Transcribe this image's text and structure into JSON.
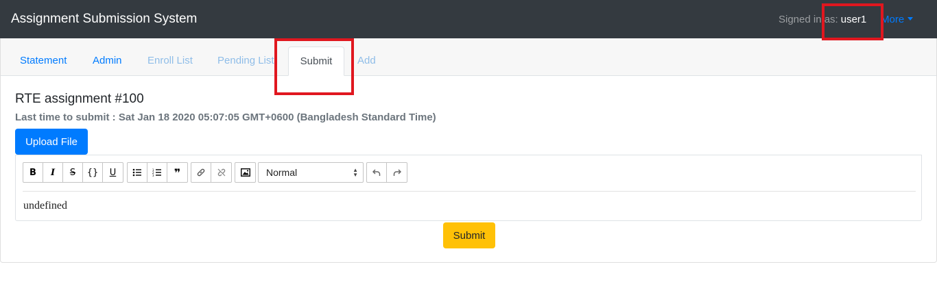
{
  "navbar": {
    "brand": "Assignment Submission System",
    "signed_in_label": "Signed in as:",
    "username": "user1",
    "more_label": "More"
  },
  "tabs": [
    {
      "label": "Statement"
    },
    {
      "label": "Admin"
    },
    {
      "label": "Enroll List"
    },
    {
      "label": "Pending List"
    },
    {
      "label": "Submit",
      "active": true
    },
    {
      "label": "Add"
    }
  ],
  "assignment": {
    "title": "RTE assignment #100",
    "deadline": "Last time to submit : Sat Jan 18 2020 05:07:05 GMT+0600 (Bangladesh Standard Time)",
    "upload_label": "Upload File"
  },
  "editor": {
    "format_select": "Normal",
    "toolbar_icons": [
      "bold-icon",
      "italic-icon",
      "strike-icon",
      "code-icon",
      "underline-icon",
      "bullet-list-icon",
      "ordered-list-icon",
      "blockquote-icon",
      "link-icon",
      "unlink-icon",
      "image-icon",
      "undo-icon",
      "redo-icon"
    ],
    "content": "undefined"
  },
  "submit_label": "Submit",
  "colors": {
    "navbar": "#343a40",
    "primary": "#007bff",
    "warning": "#ffc107",
    "annotation": "#e0171f"
  }
}
